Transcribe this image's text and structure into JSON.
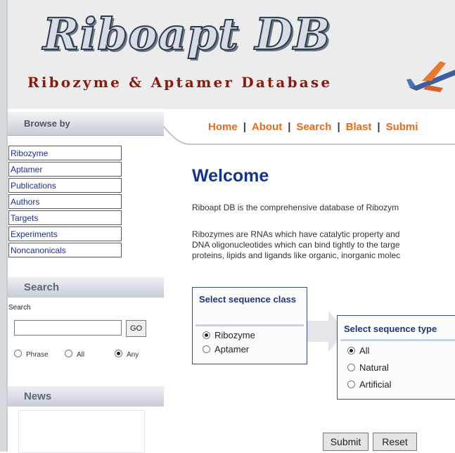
{
  "header": {
    "logo_title": "Riboapt DB",
    "logo_subtitle": "Ribozyme & Aptamer Database",
    "logo_icon": "airplane-icon"
  },
  "nav": {
    "browse_tab": "Browse by",
    "menu": [
      "Home",
      "About",
      "Search",
      "Blast",
      "Submi"
    ],
    "separator": "|"
  },
  "sidebar": {
    "browse_links": [
      "Ribozyme",
      "Aptamer",
      "Publications",
      "Authors",
      "Targets",
      "Experiments",
      "Noncanonicals"
    ],
    "search": {
      "heading": "Search",
      "label": "Search",
      "input_value": "",
      "go_label": "GO",
      "options": [
        {
          "label": "Phrase",
          "checked": false
        },
        {
          "label": "All",
          "checked": false
        },
        {
          "label": "Any",
          "checked": true
        }
      ]
    },
    "news": {
      "heading": "News"
    }
  },
  "main": {
    "title": "Welcome",
    "intro": "Riboapt DB is the comprehensive database of Ribozym",
    "description_lines": [
      "Ribozymes are RNAs which have catalytic property and",
      "DNA oligonucleotides which can bind tightly to the targe",
      "proteins, lipids and ligands like organic, inorganic molec"
    ],
    "sequence_class": {
      "title": "Select sequence class",
      "options": [
        {
          "label": "Ribozyme",
          "checked": true
        },
        {
          "label": "Aptamer",
          "checked": false
        }
      ]
    },
    "sequence_type": {
      "title": "Select sequence type",
      "options": [
        {
          "label": "All",
          "checked": true
        },
        {
          "label": "Natural",
          "checked": false
        },
        {
          "label": "Artificial",
          "checked": false
        }
      ]
    },
    "submit_label": "Submit",
    "reset_label": "Reset"
  },
  "colors": {
    "brand_dark": "#2c3b4f",
    "subtitle_red": "#8a1a0c",
    "menu_orange": "#e86a1d",
    "link_blue": "#1d2f8e",
    "heading_blue": "#14338c"
  }
}
